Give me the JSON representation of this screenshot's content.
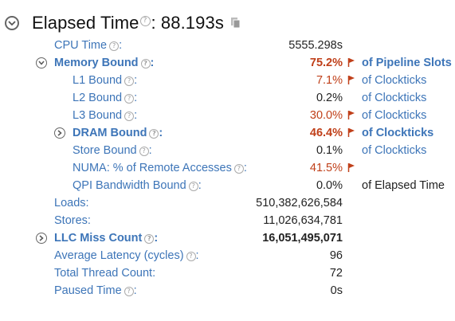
{
  "header": {
    "title": "Elapsed Time",
    "value_text": ": 88.193s",
    "help": "?"
  },
  "colors": {
    "link": "#3d75b8",
    "alert": "#c0401a",
    "text": "#222222"
  },
  "rows": [
    {
      "label": "CPU Time",
      "suffix": ":",
      "value": "5555.298s",
      "unit": ""
    },
    {
      "label": "Memory Bound",
      "suffix": ":",
      "value": "75.2%",
      "unit": "of Pipeline Slots",
      "flag": true,
      "expand": "collapse"
    },
    {
      "label": "L1 Bound",
      "suffix": ":",
      "value": "7.1%",
      "unit": "of Clockticks",
      "flag": true
    },
    {
      "label": "L2 Bound",
      "suffix": ":",
      "value": "0.2%",
      "unit": "of Clockticks"
    },
    {
      "label": "L3 Bound",
      "suffix": ":",
      "value": "30.0%",
      "unit": "of Clockticks",
      "flag": true
    },
    {
      "label": "DRAM Bound",
      "suffix": ":",
      "value": "46.4%",
      "unit": "of Clockticks",
      "flag": true,
      "expand": "expand"
    },
    {
      "label": "Store Bound",
      "suffix": ":",
      "value": "0.1%",
      "unit": "of Clockticks"
    },
    {
      "label": "NUMA: % of Remote Accesses",
      "suffix": ":",
      "value": "41.5%",
      "unit": "",
      "flag": true
    },
    {
      "label": "QPI Bandwidth Bound",
      "suffix": ":",
      "value": "0.0%",
      "unit": "of Elapsed Time"
    },
    {
      "label": "Loads",
      "suffix": ":",
      "value": "510,382,626,584",
      "unit": ""
    },
    {
      "label": "Stores",
      "suffix": ":",
      "value": "11,026,634,781",
      "unit": ""
    },
    {
      "label": "LLC Miss Count",
      "suffix": ":",
      "value": "16,051,495,071",
      "unit": "",
      "expand": "expand"
    },
    {
      "label": "Average Latency (cycles)",
      "suffix": ":",
      "value": "96",
      "unit": ""
    },
    {
      "label": "Total Thread Count",
      "suffix": ":",
      "value": "72",
      "unit": ""
    },
    {
      "label": "Paused Time",
      "suffix": ":",
      "value": "0s",
      "unit": ""
    }
  ]
}
